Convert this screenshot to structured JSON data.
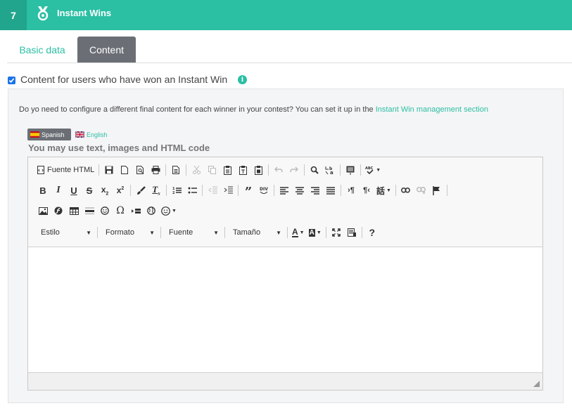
{
  "header": {
    "step": "7",
    "icon": "medal-icon",
    "title": "Instant Wins",
    "accent_color": "#2bbfa4"
  },
  "tabs": [
    {
      "label": "Basic data",
      "active": false
    },
    {
      "label": "Content",
      "active": true
    }
  ],
  "option": {
    "checked": true,
    "label": "Content for users who have won an Instant Win",
    "info_icon": "i"
  },
  "panel": {
    "description": "Do yo need to configure a different final content for each winner in your contest? You can set it up in the ",
    "link_text": "Instant Win management section",
    "languages": [
      {
        "label": "Spanish",
        "active": true
      },
      {
        "label": "English",
        "active": false
      }
    ],
    "helper": "You may use text, images and HTML code"
  },
  "editor": {
    "source_label": "Fuente HTML",
    "combos": [
      {
        "label": "Estilo"
      },
      {
        "label": "Formato"
      },
      {
        "label": "Fuente"
      },
      {
        "label": "Tamaño"
      }
    ],
    "quote_label": "”",
    "omega_label": "Ω",
    "help_label": "?",
    "content": ""
  }
}
